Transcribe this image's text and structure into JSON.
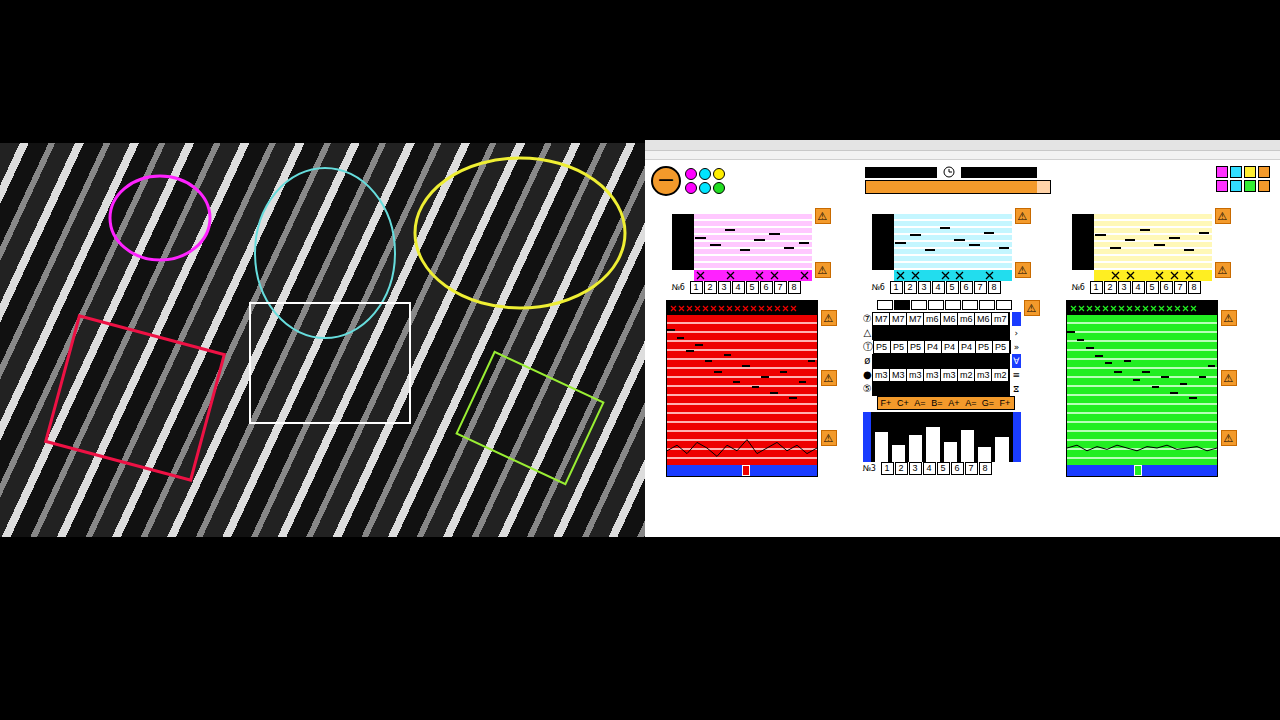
{
  "transport": {
    "level": 0.93
  },
  "warning": "⚠",
  "stop_glyph": "−",
  "voice_dots": [
    {
      "color": "#ff00ff"
    },
    {
      "color": "#00e5ff"
    },
    {
      "color": "#ffee00"
    },
    {
      "color": "#ff00ff"
    },
    {
      "color": "#00e5ff"
    },
    {
      "color": "#22dd22"
    }
  ],
  "toggles": [
    {
      "color": "#ff33ff"
    },
    {
      "color": "#33ddff"
    },
    {
      "color": "#ffee33"
    },
    {
      "color": "#f39a2b"
    },
    {
      "color": "#ff33ff"
    },
    {
      "color": "#33ddff"
    },
    {
      "color": "#33ee33"
    },
    {
      "color": "#f39a2b"
    }
  ],
  "steps": [
    "1",
    "2",
    "3",
    "4",
    "5",
    "6",
    "7",
    "8"
  ],
  "voices": [
    {
      "color": "#ff22ff",
      "light": "#ffc8ff",
      "label": "№6",
      "notes": [
        0.55,
        0.4,
        0.7,
        0.3,
        0.5,
        0.62,
        0.35,
        0.45
      ],
      "gates": [
        true,
        false,
        true,
        false,
        true,
        true,
        false,
        true
      ]
    },
    {
      "color": "#22ddee",
      "light": "#c4f6ff",
      "label": "№6",
      "notes": [
        0.45,
        0.6,
        0.3,
        0.75,
        0.5,
        0.4,
        0.65,
        0.35
      ],
      "gates": [
        true,
        true,
        false,
        true,
        true,
        false,
        true,
        false
      ]
    },
    {
      "color": "#ffee22",
      "light": "#fff8b8",
      "label": "№6",
      "notes": [
        0.6,
        0.35,
        0.5,
        0.7,
        0.4,
        0.55,
        0.3,
        0.65
      ],
      "gates": [
        false,
        true,
        true,
        false,
        true,
        true,
        true,
        false
      ]
    }
  ],
  "leads": [
    {
      "color": "#ee0000",
      "light": "#ffb0b0",
      "notes": [
        0.9,
        0.82,
        0.7,
        0.75,
        0.6,
        0.5,
        0.66,
        0.4,
        0.55,
        0.35,
        0.45,
        0.3,
        0.5,
        0.25,
        0.4,
        0.6
      ],
      "curve": [
        0.4,
        0.6,
        0.3,
        0.7,
        0.5,
        0.2,
        0.6,
        0.4,
        0.8,
        0.3,
        0.5,
        0.7,
        0.4,
        0.6,
        0.3,
        0.5
      ],
      "position": 0.5
    },
    {
      "color": "#22ee22",
      "light": "#b8ffb8",
      "notes": [
        0.88,
        0.8,
        0.72,
        0.65,
        0.58,
        0.5,
        0.6,
        0.42,
        0.5,
        0.35,
        0.45,
        0.3,
        0.38,
        0.25,
        0.45,
        0.55
      ],
      "curve": [
        0.5,
        0.6,
        0.4,
        0.55,
        0.45,
        0.6,
        0.5,
        0.4,
        0.55,
        0.5,
        0.6,
        0.45,
        0.5,
        0.55,
        0.4,
        0.5
      ],
      "position": 0.45
    }
  ],
  "chords": {
    "counter": "№3",
    "rows": [
      {
        "symbol": "⑦",
        "cells": [
          "M7",
          "M7",
          "M7",
          "m6",
          "M6",
          "m6",
          "M6",
          "m7"
        ],
        "side": "",
        "selected": true
      },
      {
        "symbol": "△",
        "cells": [],
        "side": "›",
        "selected": false
      },
      {
        "symbol": "Ⓣ",
        "cells": [
          "P5",
          "P5",
          "P5",
          "P4",
          "P4",
          "P4",
          "P5",
          "P5"
        ],
        "side": "»",
        "selected": false
      },
      {
        "symbol": "ø",
        "cells": [],
        "side": "∀",
        "selected": true
      },
      {
        "symbol": "●",
        "cells": [
          "m3",
          "M3",
          "m3",
          "m3",
          "m3",
          "m2",
          "m3",
          "m2"
        ],
        "side": "≡",
        "selected": false
      },
      {
        "symbol": "⑤",
        "cells": [],
        "side": "⧖",
        "selected": false
      }
    ],
    "roots": [
      "F+",
      "C+",
      "A=",
      "B=",
      "A+",
      "A=",
      "G=",
      "F+"
    ],
    "bars": [
      0.6,
      0.35,
      0.55,
      0.7,
      0.4,
      0.65,
      0.3,
      0.5
    ]
  }
}
